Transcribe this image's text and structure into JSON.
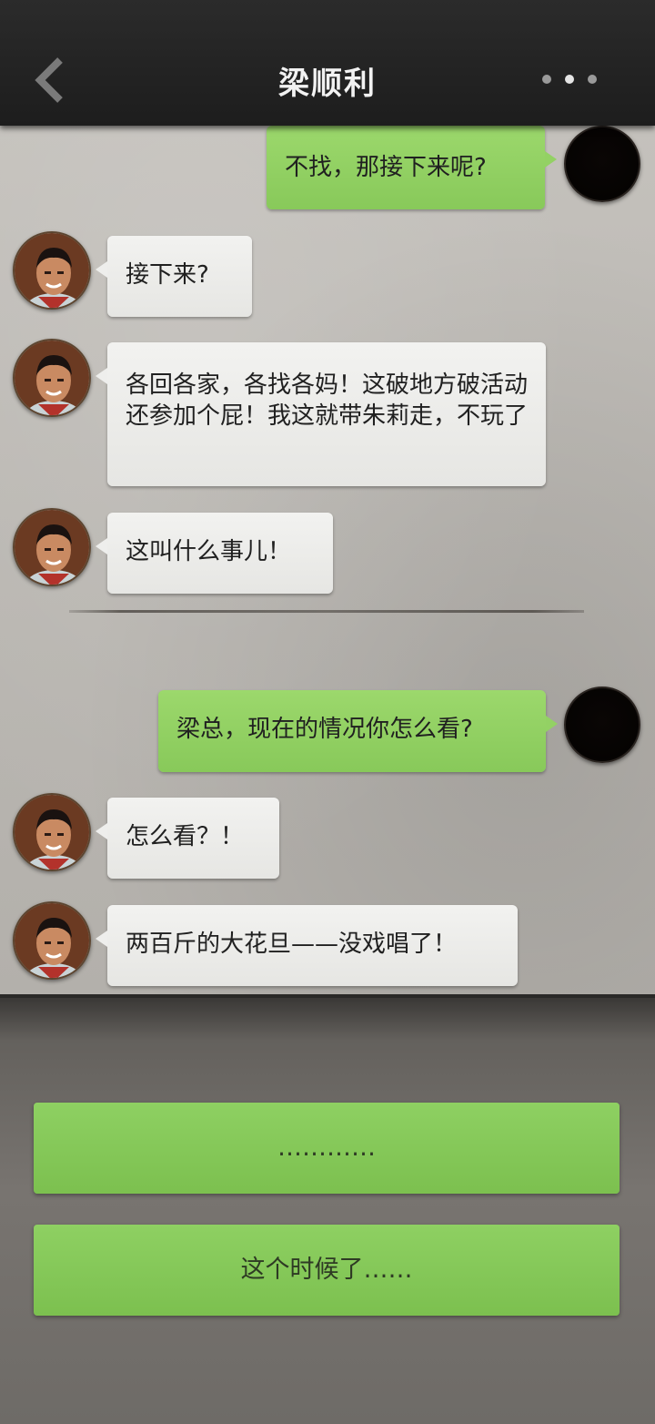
{
  "header": {
    "title": "梁顺利"
  },
  "messages": [
    {
      "side": "right",
      "text": "不找，那接下来呢?"
    },
    {
      "side": "left",
      "text": "接下来?"
    },
    {
      "side": "left",
      "text": "各回各家，各找各妈！这破地方破活动还参加个屁！我这就带朱莉走，不玩了"
    },
    {
      "side": "left",
      "text": "这叫什么事儿！"
    },
    {
      "side": "right",
      "text": "梁总，现在的情况你怎么看?"
    },
    {
      "side": "left",
      "text": "怎么看？！"
    },
    {
      "side": "left",
      "text": "两百斤的大花旦——没戏唱了！"
    }
  ],
  "choices": [
    {
      "text": "…………"
    },
    {
      "text": "这个时候了……"
    }
  ]
}
